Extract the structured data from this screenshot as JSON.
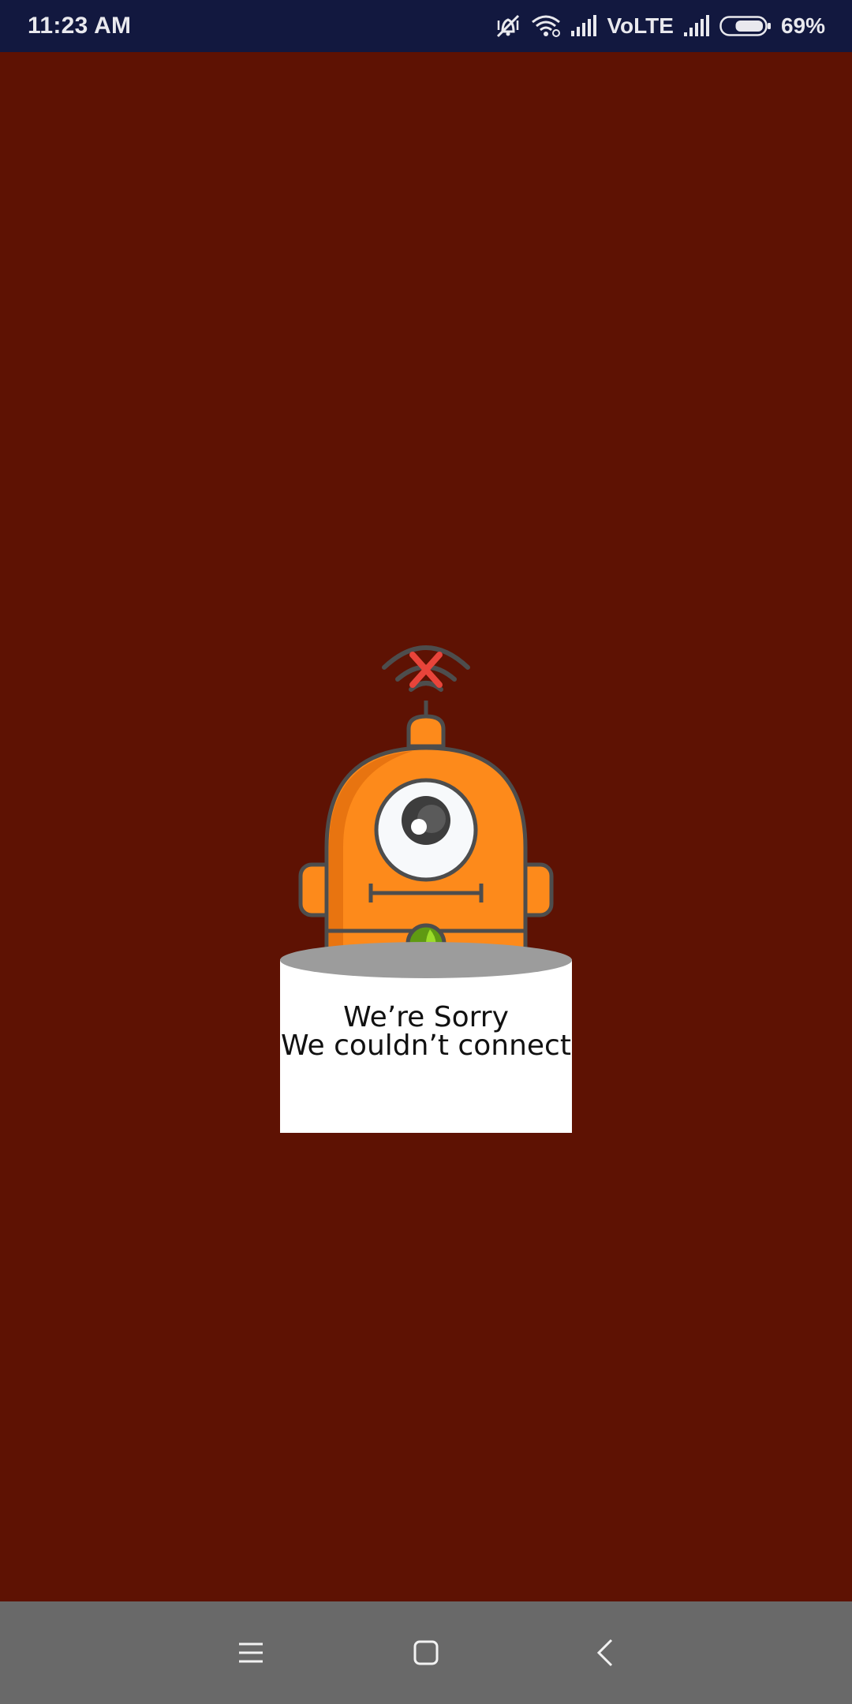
{
  "status_bar": {
    "time": "11:23 AM",
    "network_label": "VoLTE",
    "battery_percent": "69%",
    "battery_level": 0.69,
    "icons": [
      "mute-vibrate-icon",
      "wifi-icon",
      "signal-icon",
      "signal-icon-2",
      "battery-icon"
    ]
  },
  "error_screen": {
    "title": "We’re Sorry",
    "subtitle": "We couldn’t connect",
    "illustration": "robot-no-wifi-illustration",
    "colors": {
      "background": "#5e1203",
      "robot_body": "#fd8a1b",
      "robot_outline": "#4d4d4d",
      "error_x": "#e9443a",
      "light": "#7cc21b",
      "pedestal_top": "#9c9c9c",
      "pedestal_body": "#ffffff"
    }
  },
  "nav_bar": {
    "buttons": [
      "menu-icon",
      "home-icon",
      "back-icon"
    ],
    "background": "#696969"
  }
}
